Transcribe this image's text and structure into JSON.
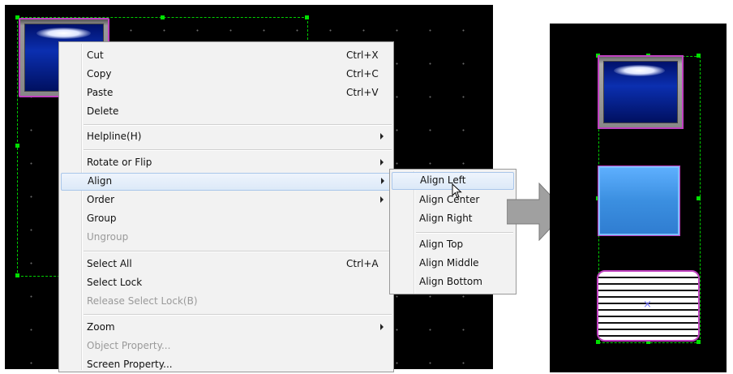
{
  "context_menu": {
    "items": [
      {
        "label": "Cut",
        "shortcut": "Ctrl+X"
      },
      {
        "label": "Copy",
        "shortcut": "Ctrl+C"
      },
      {
        "label": "Paste",
        "shortcut": "Ctrl+V"
      },
      {
        "label": "Delete"
      },
      {
        "label": "Helpline(H)"
      },
      {
        "label": "Rotate or Flip"
      },
      {
        "label": "Align"
      },
      {
        "label": "Order"
      },
      {
        "label": "Group"
      },
      {
        "label": "Ungroup"
      },
      {
        "label": "Select All",
        "shortcut": "Ctrl+A"
      },
      {
        "label": "Select Lock"
      },
      {
        "label": "Release Select Lock(B)"
      },
      {
        "label": "Zoom"
      },
      {
        "label": "Object Property..."
      },
      {
        "label": "Screen Property..."
      }
    ]
  },
  "align_submenu": {
    "items": [
      {
        "label": "Align Left"
      },
      {
        "label": "Align Center"
      },
      {
        "label": "Align Right"
      },
      {
        "label": "Align Top"
      },
      {
        "label": "Align Middle"
      },
      {
        "label": "Align Bottom"
      }
    ]
  },
  "colors": {
    "canvas_bg": "#000000",
    "selection_green": "#00e000",
    "object_magenta": "#c040c0",
    "highlight_bg": "#dce9f8",
    "button_blue": "#3b8fe0"
  },
  "icons": {
    "cursor": "mouse-pointer-icon",
    "arrow": "right-arrow-icon",
    "center_mark": "x-mark-icon"
  },
  "preview": {
    "center_mark": "×"
  }
}
